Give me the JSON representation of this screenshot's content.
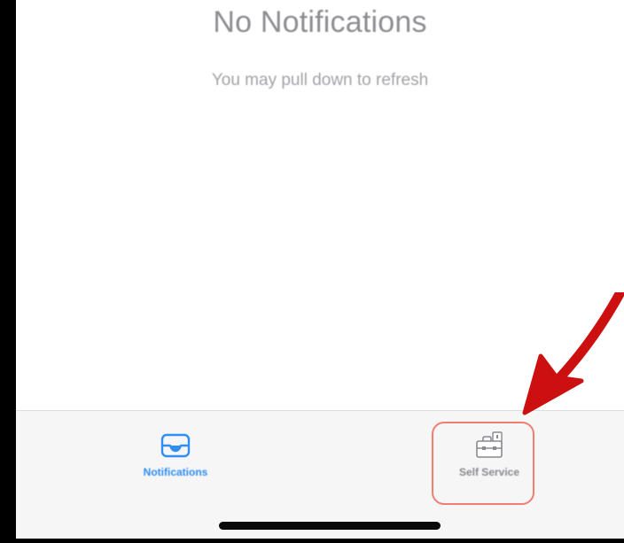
{
  "empty_state": {
    "title": "No Notifications",
    "subtitle": "You may pull down to refresh"
  },
  "tabbar": {
    "tabs": [
      {
        "label": "Notifications",
        "icon": "inbox-tray-icon",
        "selected": true
      },
      {
        "label": "Self Service",
        "icon": "toolbox-icon",
        "selected": false
      }
    ]
  },
  "annotation": {
    "highlight_color": "#ee7f72",
    "arrow_color": "#cc1010"
  },
  "colors": {
    "active_tab": "#2f8ef0",
    "inactive_tab": "#8a8a8f",
    "tabbar_background": "#f6f6f7"
  }
}
